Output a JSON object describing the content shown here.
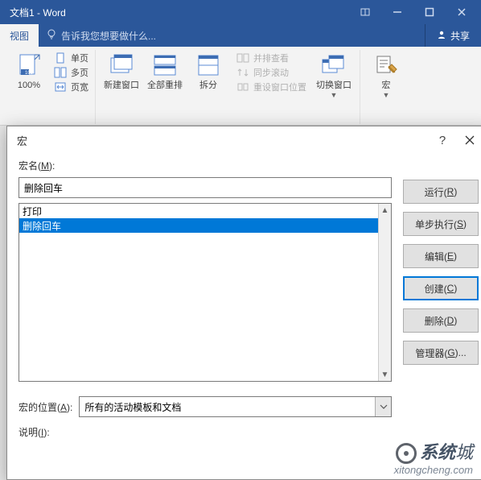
{
  "titlebar": {
    "title": "文档1 - Word"
  },
  "ribbon": {
    "active_tab": "视图",
    "tellme_placeholder": "告诉我您想要做什么...",
    "share": "共享",
    "zoom": {
      "big_label": "100%",
      "items": [
        "单页",
        "多页",
        "页宽"
      ]
    },
    "window": {
      "new_window": "新建窗口",
      "arrange_all": "全部重排",
      "split": "拆分",
      "side_by_side": "并排查看",
      "sync_scroll": "同步滚动",
      "reset_pos": "重设窗口位置",
      "switch": "切换窗口"
    },
    "macros": {
      "label": "宏"
    }
  },
  "dialog": {
    "title": "宏",
    "macro_name_label_pre": "宏名(",
    "macro_name_label_u": "M",
    "macro_name_label_post": "):",
    "macro_name_value": "删除回车",
    "list": [
      "打印",
      "删除回车"
    ],
    "selected_index": 1,
    "buttons": {
      "run": {
        "text": "运行(",
        "u": "R",
        "post": ")"
      },
      "step": {
        "text": "单步执行(",
        "u": "S",
        "post": ")"
      },
      "edit": {
        "text": "编辑(",
        "u": "E",
        "post": ")"
      },
      "create": {
        "text": "创建(",
        "u": "C",
        "post": ")"
      },
      "delete": {
        "text": "删除(",
        "u": "D",
        "post": ")"
      },
      "organizer": {
        "text": "管理器(",
        "u": "G",
        "post": ")..."
      }
    },
    "location_label_pre": "宏的位置(",
    "location_label_u": "A",
    "location_label_post": "):",
    "location_value": "所有的活动模板和文档",
    "desc_label_pre": "说明(",
    "desc_label_u": "I",
    "desc_label_post": "):"
  },
  "watermark": {
    "line1_bold": "系统",
    "line1_rest": "城",
    "line2": "xitongcheng.com"
  }
}
